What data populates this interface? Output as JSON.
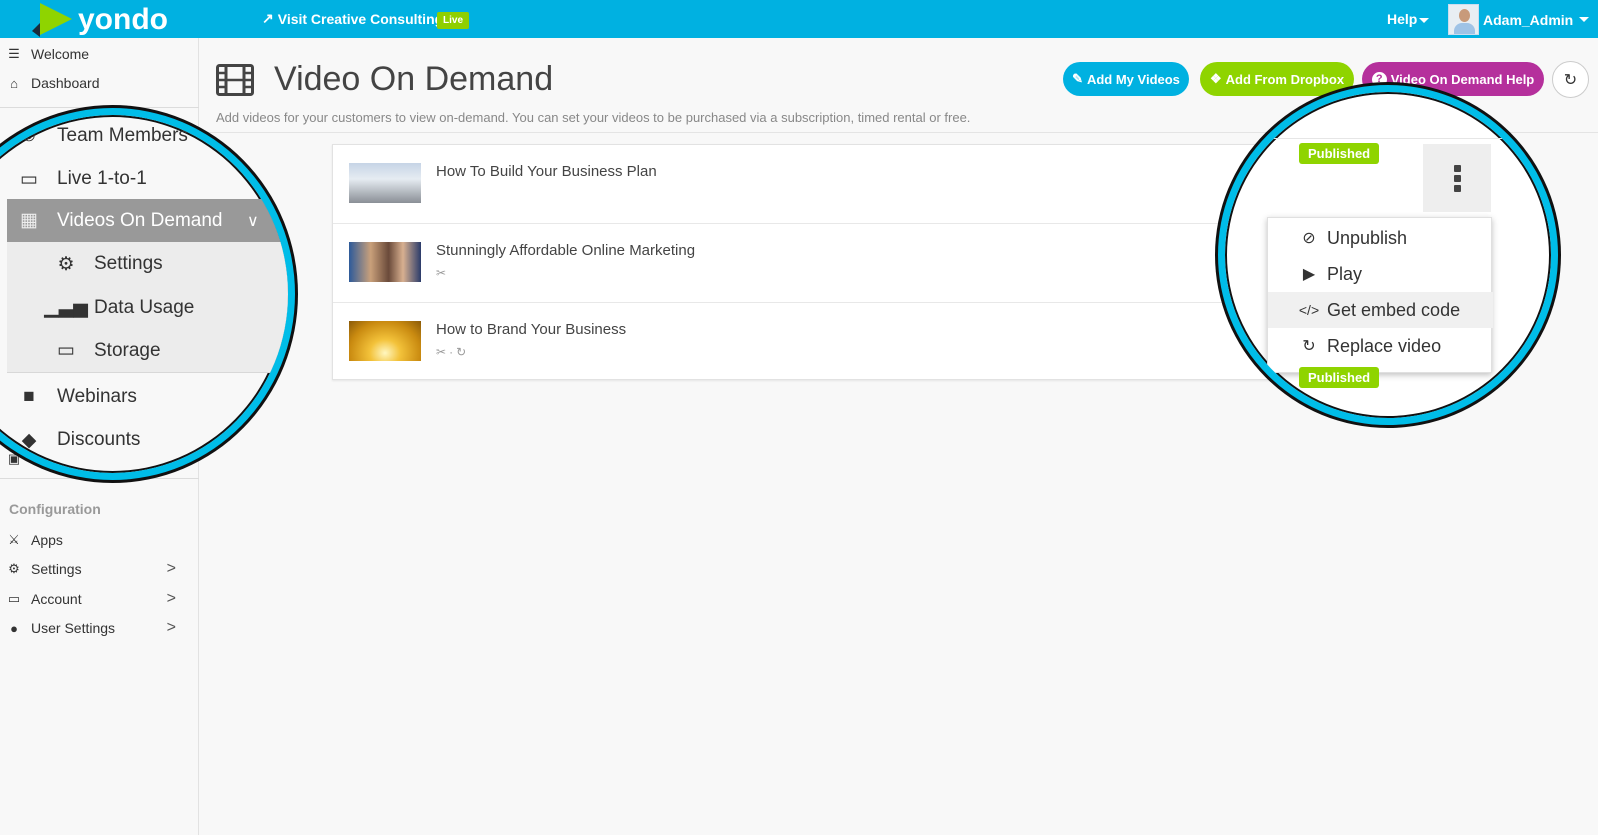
{
  "topbar": {
    "brand": "yondo",
    "visit_link": "Visit Creative Consulting",
    "live_badge": "Live",
    "help_label": "Help",
    "user_name": "Adam_Admin"
  },
  "sidebar": {
    "top_items": [
      {
        "label": "Welcome",
        "icon": "list-ol-icon"
      },
      {
        "label": "Dashboard",
        "icon": "home-icon"
      }
    ],
    "partial_item_icon": "money-icon",
    "config_heading": "Configuration",
    "config_items": [
      {
        "label": "Apps",
        "icon": "plug-icon"
      },
      {
        "label": "Settings",
        "icon": "gear-icon",
        "chevron": ">"
      },
      {
        "label": "Account",
        "icon": "credit-card-icon",
        "chevron": ">"
      },
      {
        "label": "User Settings",
        "icon": "user-icon",
        "chevron": ">"
      }
    ]
  },
  "magnifier_left": {
    "items": [
      {
        "label": "Team Members",
        "icon": "users-icon"
      },
      {
        "label": "Live 1-to-1",
        "icon": "desktop-icon"
      },
      {
        "label": "Videos On Demand",
        "icon": "film-icon",
        "active": true
      },
      {
        "label": "Settings",
        "icon": "gear-icon",
        "sub": true
      },
      {
        "label": "Data Usage",
        "icon": "bar-chart-icon",
        "sub": true
      },
      {
        "label": "Storage",
        "icon": "hdd-icon",
        "sub": true
      },
      {
        "label": "Webinars",
        "icon": "video-camera-icon"
      },
      {
        "label": "Discounts",
        "icon": "tags-icon"
      }
    ]
  },
  "page": {
    "title": "Video On Demand",
    "subtitle": "Add videos for your customers to view on-demand. You can set your videos to be purchased via a subscription, timed rental or free.",
    "buttons": {
      "add_videos": "Add My Videos",
      "add_dropbox": "Add From Dropbox",
      "help": "Video On Demand Help"
    }
  },
  "videos": [
    {
      "title": "How To Build Your Business Plan",
      "meta": []
    },
    {
      "title": "Stunningly Affordable Online Marketing",
      "meta": [
        "ticket-icon"
      ]
    },
    {
      "title": "How to Brand Your Business",
      "meta": [
        "ticket-icon",
        "·",
        "refresh-icon"
      ]
    }
  ],
  "magnifier_right": {
    "status_badge": "Published",
    "status_badge_2": "Published",
    "menu_items": [
      {
        "label": "Unpublish",
        "icon": "ban-icon"
      },
      {
        "label": "Play",
        "icon": "play-icon"
      },
      {
        "label": "Get embed code",
        "icon": "code-icon",
        "highlighted": true
      },
      {
        "label": "Replace video",
        "icon": "refresh-icon"
      }
    ]
  },
  "colors": {
    "brand": "#00b1e1",
    "green": "#8fd400",
    "purple": "#b5309c",
    "magnifier_ring": "#00bde8"
  }
}
